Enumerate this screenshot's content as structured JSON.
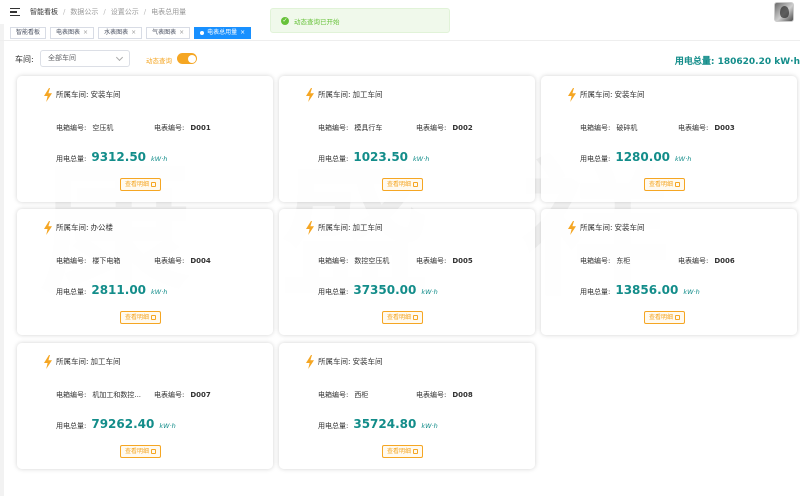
{
  "breadcrumb": [
    "智能看板",
    "数据公示",
    "设置公示",
    "电表总用量"
  ],
  "toast": {
    "message": "动态查询已开始"
  },
  "tags": [
    {
      "label": "智能看板",
      "closable": false,
      "active": false
    },
    {
      "label": "电表图表",
      "closable": true,
      "active": false
    },
    {
      "label": "水表图表",
      "closable": true,
      "active": false
    },
    {
      "label": "气表图表",
      "closable": true,
      "active": false
    },
    {
      "label": "电表总用量",
      "closable": true,
      "active": true
    }
  ],
  "filter": {
    "workshop_label": "车间:",
    "workshop_value": "全部车间",
    "switch_label": "动态查询",
    "switch_on": true
  },
  "total": "用电总量: 180620.20 kW·h",
  "watermark": "康盛祥",
  "card_labels": {
    "workshop": "所属车间:",
    "box": "电箱编号:",
    "meter": "电表编号:",
    "usage": "用电总量:",
    "unit": "kW·h",
    "detail": "查看明细"
  },
  "cards": [
    {
      "workshop": "安装车间",
      "box": "空压机",
      "meter": "D001",
      "usage": "9312.50"
    },
    {
      "workshop": "加工车间",
      "box": "模具行车",
      "meter": "D002",
      "usage": "1023.50"
    },
    {
      "workshop": "安装车间",
      "box": "破碎机",
      "meter": "D003",
      "usage": "1280.00"
    },
    {
      "workshop": "办公楼",
      "box": "楼下电箱",
      "meter": "D004",
      "usage": "2811.00"
    },
    {
      "workshop": "加工车间",
      "box": "数控空压机",
      "meter": "D005",
      "usage": "37350.00"
    },
    {
      "workshop": "安装车间",
      "box": "东柜",
      "meter": "D006",
      "usage": "13856.00"
    },
    {
      "workshop": "加工车间",
      "box": "机加工和数控...",
      "meter": "D007",
      "usage": "79262.40"
    },
    {
      "workshop": "安装车间",
      "box": "西柜",
      "meter": "D008",
      "usage": "35724.80"
    }
  ],
  "colors": {
    "accent": "#138d8a",
    "warning": "#f5a623",
    "active_tag": "#1890ff",
    "success": "#67c23a"
  }
}
